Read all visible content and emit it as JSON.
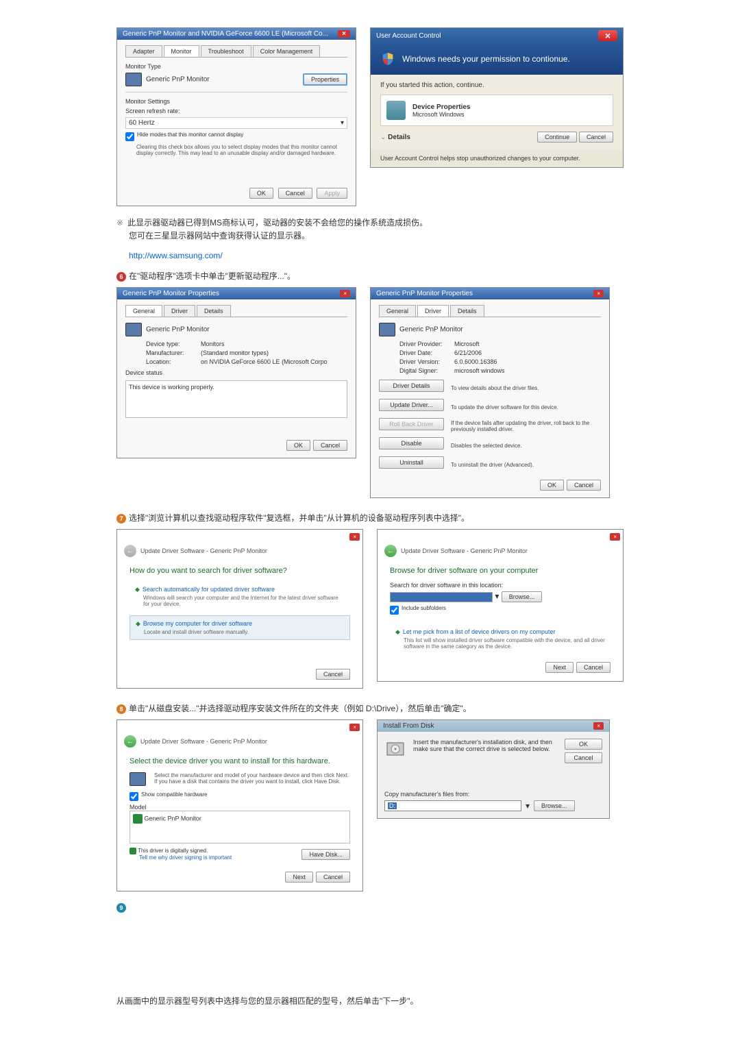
{
  "monitor_dialog": {
    "title": "Generic PnP Monitor and NVIDIA GeForce 6600 LE (Microsoft Co...",
    "tabs": [
      "Adapter",
      "Monitor",
      "Troubleshoot",
      "Color Management"
    ],
    "type_label": "Monitor Type",
    "type_value": "Generic PnP Monitor",
    "properties_btn": "Properties",
    "settings_label": "Monitor Settings",
    "refresh_label": "Screen refresh rate:",
    "refresh_value": "60 Hertz",
    "hide_modes": "Hide modes that this monitor cannot display",
    "hide_desc": "Clearing this check box allows you to select display modes that this monitor cannot display correctly. This may lead to an unusable display and/or damaged hardware.",
    "ok": "OK",
    "cancel": "Cancel",
    "apply": "Apply"
  },
  "uac": {
    "title": "User Account Control",
    "heading": "Windows needs your permission to contionue.",
    "started": "If you started this action, continue.",
    "prog": "Device Properties",
    "pub": "Microsoft Windows",
    "details": "Details",
    "continue": "Continue",
    "cancel": "Cancel",
    "footer": "User Account Control helps stop unauthorized changes to your computer."
  },
  "note": {
    "line1": "此显示器驱动器已得到MS商标认可，驱动器的安装不会给您的操作系统造成损伤。",
    "line2": "您可在三星显示器网站中查询获得认证的显示器。",
    "url": "http://www.samsung.com/"
  },
  "step6": "在\"驱动程序\"选项卡中单击\"更新驱动程序...\"。",
  "step7": "选择\"浏览计算机以查找驱动程序软件\"复选框，并单击\"从计算机的设备驱动程序列表中选择\"。",
  "step8": "单击\"从磁盘安装...\"并选择驱动程序安装文件所在的文件夹（例如 D:\\Drive），然后单击\"确定\"。",
  "prop_general": {
    "title": "Generic PnP Monitor Properties",
    "tabs": [
      "General",
      "Driver",
      "Details"
    ],
    "name": "Generic PnP Monitor",
    "device_type_l": "Device type:",
    "device_type_v": "Monitors",
    "manu_l": "Manufacturer:",
    "manu_v": "(Standard monitor types)",
    "loc_l": "Location:",
    "loc_v": "on NVIDIA GeForce 6600 LE (Microsoft Corpo",
    "status_l": "Device status",
    "status_v": "This device is working properly.",
    "ok": "OK",
    "cancel": "Cancel"
  },
  "prop_driver": {
    "title": "Generic PnP Monitor Properties",
    "tabs": [
      "General",
      "Driver",
      "Details"
    ],
    "name": "Generic PnP Monitor",
    "provider_l": "Driver Provider:",
    "provider_v": "Microsoft",
    "date_l": "Driver Date:",
    "date_v": "6/21/2006",
    "ver_l": "Driver Version:",
    "ver_v": "6.0.6000.16386",
    "signer_l": "Digital Signer:",
    "signer_v": "microsoft windows",
    "btn_details": "Driver Details",
    "btn_details_d": "To view details about the driver files.",
    "btn_update": "Update Driver...",
    "btn_update_d": "To update the driver software for this device.",
    "btn_rollback": "Roll Back Driver",
    "btn_rollback_d": "If the device fails after updating the driver, roll back to the previously installed driver.",
    "btn_disable": "Disable",
    "btn_disable_d": "Disables the selected device.",
    "btn_uninstall": "Uninstall",
    "btn_uninstall_d": "To uninstall the driver (Advanced).",
    "ok": "OK",
    "cancel": "Cancel"
  },
  "wiz1": {
    "breadcrumb": "Update Driver Software - Generic PnP Monitor",
    "title": "How do you want to search for driver software?",
    "opt1_t": "Search automatically for updated driver software",
    "opt1_d": "Windows will search your computer and the Internet for the latest driver software for your device.",
    "opt2_t": "Browse my computer for driver software",
    "opt2_d": "Locate and install driver software manually.",
    "cancel": "Cancel"
  },
  "wiz2": {
    "breadcrumb": "Update Driver Software - Generic PnP Monitor",
    "title": "Browse for driver software on your computer",
    "search_l": "Search for driver software in this location:",
    "browse": "Browse...",
    "include": "Include subfolders",
    "opt_t": "Let me pick from a list of device drivers on my computer",
    "opt_d": "This list will show installed driver software compatible with the device, and all driver software in the same category as the device.",
    "next": "Next",
    "cancel": "Cancel"
  },
  "wiz3": {
    "breadcrumb": "Update Driver Software - Generic PnP Monitor",
    "title": "Select the device driver you want to install for this hardware.",
    "instr": "Select the manufacturer and model of your hardware device and then click Next. If you have a disk that contains the driver you want to install, click Have Disk.",
    "compat": "Show compatible hardware",
    "model_l": "Model",
    "model_v": "Generic PnP Monitor",
    "signed": "This driver is digitally signed.",
    "tell": "Tell me why driver signing is important",
    "have_disk": "Have Disk...",
    "next": "Next",
    "cancel": "Cancel"
  },
  "install": {
    "title": "Install From Disk",
    "instr": "Insert the manufacturer's installation disk, and then make sure that the correct drive is selected below.",
    "ok": "OK",
    "cancel": "Cancel",
    "copy_l": "Copy manufacturer's files from:",
    "path": "D:",
    "browse": "Browse..."
  },
  "final": "从画面中的显示器型号列表中选择与您的显示器相匹配的型号，然后单击\"下一步\"。"
}
